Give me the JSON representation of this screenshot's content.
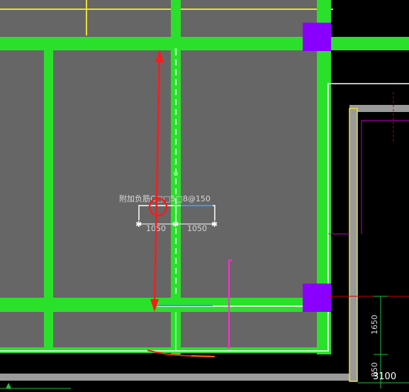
{
  "annotation": {
    "rebar_text": "附加负筋C□□5□8@150",
    "dim_left": "1050",
    "dim_right": "1050"
  },
  "dimensions": {
    "vertical_1": "1650",
    "vertical_2": "850",
    "horizontal": "3100"
  },
  "colors": {
    "canvas": "#000000",
    "slab": "#666666",
    "beam": "#2be02b",
    "column": "#8a00ff",
    "axis": "#e6e03a",
    "markup": "#ff1a1a",
    "dim": "#1fbf3a",
    "magenta": "#ff2bd6",
    "wall": "#9a9a9a"
  }
}
